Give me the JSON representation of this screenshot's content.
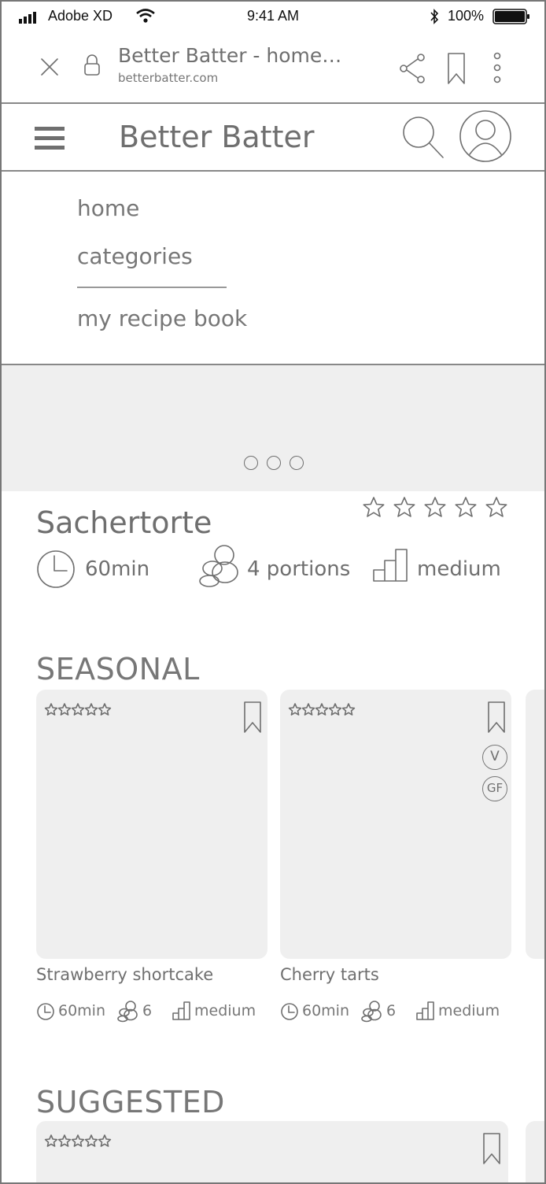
{
  "status_bar": {
    "carrier": "Adobe XD",
    "time": "9:41 AM",
    "battery": "100%"
  },
  "browser": {
    "title": "Better Batter - home…",
    "url": "betterbatter.com"
  },
  "app": {
    "brand": "Better Batter"
  },
  "menu": {
    "items": [
      "home",
      "categories",
      "my recipe book"
    ]
  },
  "featured": {
    "title": "Sachertorte",
    "time": "60min",
    "portions": "4 portions",
    "difficulty": "medium",
    "rating_stars": 5
  },
  "seasonal": {
    "title": "SEASONAL",
    "cards": [
      {
        "name": "Strawberry shortcake",
        "time": "60min",
        "servings": "6",
        "difficulty": "medium"
      },
      {
        "name": "Cherry tarts",
        "time": "60min",
        "servings": "6",
        "difficulty": "medium",
        "badges": [
          "V",
          "GF"
        ]
      }
    ]
  },
  "suggested": {
    "title": "SUGGESTED"
  }
}
